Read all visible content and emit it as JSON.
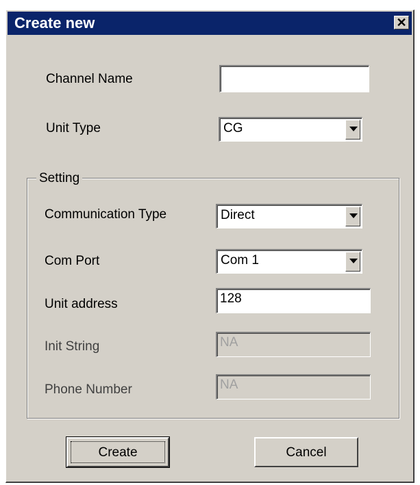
{
  "window": {
    "title": "Create new",
    "close_glyph": "✕"
  },
  "fields": {
    "channel_name": {
      "label": "Channel Name",
      "value": ""
    },
    "unit_type": {
      "label": "Unit Type",
      "value": "CG"
    }
  },
  "setting": {
    "group_label": "Setting",
    "communication_type": {
      "label": "Communication Type",
      "value": "Direct"
    },
    "com_port": {
      "label": "Com Port",
      "value": "Com 1"
    },
    "unit_address": {
      "label": "Unit address",
      "value": "128"
    },
    "init_string": {
      "label": "Init String",
      "value": "NA"
    },
    "phone_number": {
      "label": "Phone Number",
      "value": "NA"
    }
  },
  "buttons": {
    "create": "Create",
    "cancel": "Cancel"
  },
  "colors": {
    "titlebar": "#0a246a",
    "face": "#d4d0c8"
  }
}
